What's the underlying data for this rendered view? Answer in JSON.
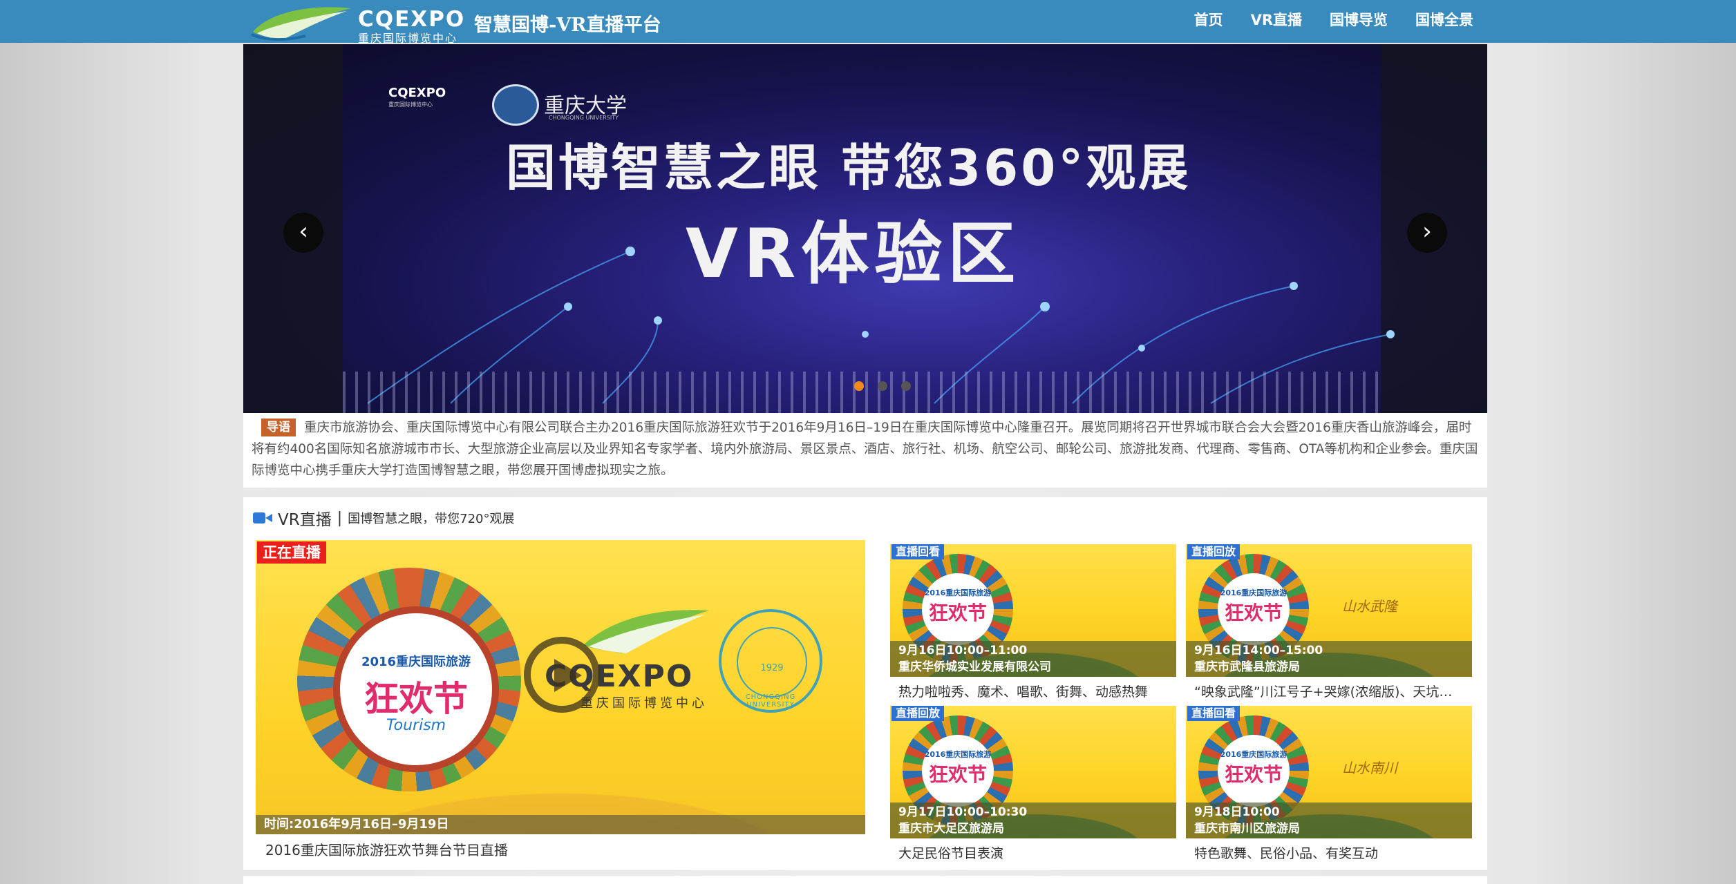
{
  "header": {
    "logo_text": "CQEXPO",
    "logo_sub": "重庆国际博览中心",
    "site_title": "智慧国博-VR直播平台",
    "nav": [
      "首页",
      "VR直播",
      "国博导览",
      "国博全景"
    ]
  },
  "banner": {
    "logo_cqexpo": "CQEXPO",
    "logo_cqexpo_sub": "重庆国际博览中心",
    "university_name": "重庆大学",
    "university_en": "CHONGQING UNIVERSITY",
    "title_line1": "国博智慧之眼   带您360°观展",
    "title_line2": "VR体验区",
    "prev": "‹",
    "next": "›",
    "slide_count": 3,
    "active_slide": 1
  },
  "intro": {
    "tag": "导语",
    "text": "重庆市旅游协会、重庆国际博览中心有限公司联合主办2016重庆国际旅游狂欢节于2016年9月16日–19日在重庆国际博览中心隆重召开。展览同期将召开世界城市联合会大会暨2016重庆香山旅游峰会，届时将有约400名国际知名旅游城市市长、大型旅游企业高层以及业界知名专家学者、境内外旅游局、景区景点、酒店、旅行社、机场、航空公司、邮轮公司、旅游批发商、代理商、零售商、OTA等机构和企业参会。重庆国际博览中心携手重庆大学打造国博智慧之眼，带您展开国博虚拟现实之旅。"
  },
  "live": {
    "section_title": "VR直播",
    "separator": "|",
    "section_subtitle": "国博智慧之眼，带您720°观展",
    "main": {
      "badge": "正在直播",
      "fest_year": "2016重庆国际旅游",
      "fest_name": "狂欢节",
      "fest_en": "Tourism",
      "brand": "CQEXPO",
      "brand_sub": "重庆国际博览中心",
      "uni_year": "1929",
      "uni_en": "CHONGQING UNIVERSITY",
      "time": "时间:2016年9月16日–9月19日",
      "caption": "2016重庆国际旅游狂欢节舞台节目直播"
    },
    "cards": [
      {
        "badge": "直播回看",
        "fest_year": "2016重庆国际旅游",
        "fest_name": "狂欢节",
        "calligraphy": "",
        "time": "9月16日10:00–11:00",
        "org": "重庆华侨城实业发展有限公司",
        "caption": "热力啦啦秀、魔术、唱歌、街舞、动感热舞"
      },
      {
        "badge": "直播回放",
        "fest_year": "2016重庆国际旅游",
        "fest_name": "狂欢节",
        "calligraphy": "山水武隆",
        "time": "9月16日14:00–15:00",
        "org": "重庆市武隆县旅游局",
        "caption": "“映象武隆”川江号子+哭嫁(浓缩版)、天坑…"
      },
      {
        "badge": "直播回放",
        "fest_year": "2016重庆国际旅游",
        "fest_name": "狂欢节",
        "calligraphy": "",
        "time": "9月17日10:00–10:30",
        "org": "重庆市大足区旅游局",
        "caption": "大足民俗节目表演"
      },
      {
        "badge": "直播回看",
        "fest_year": "2016重庆国际旅游",
        "fest_name": "狂欢节",
        "calligraphy": "山水南川",
        "time": "9月18日10:00",
        "org": "重庆市南川区旅游局",
        "caption": "特色歌舞、民俗小品、有奖互动"
      }
    ]
  },
  "colors": {
    "header_bg": "#3a8bbd",
    "live_badge": "#e8211d",
    "replay_badge": "#2e6fd3",
    "intro_tag": "#c5622c",
    "active_dot": "#f08a1c"
  }
}
